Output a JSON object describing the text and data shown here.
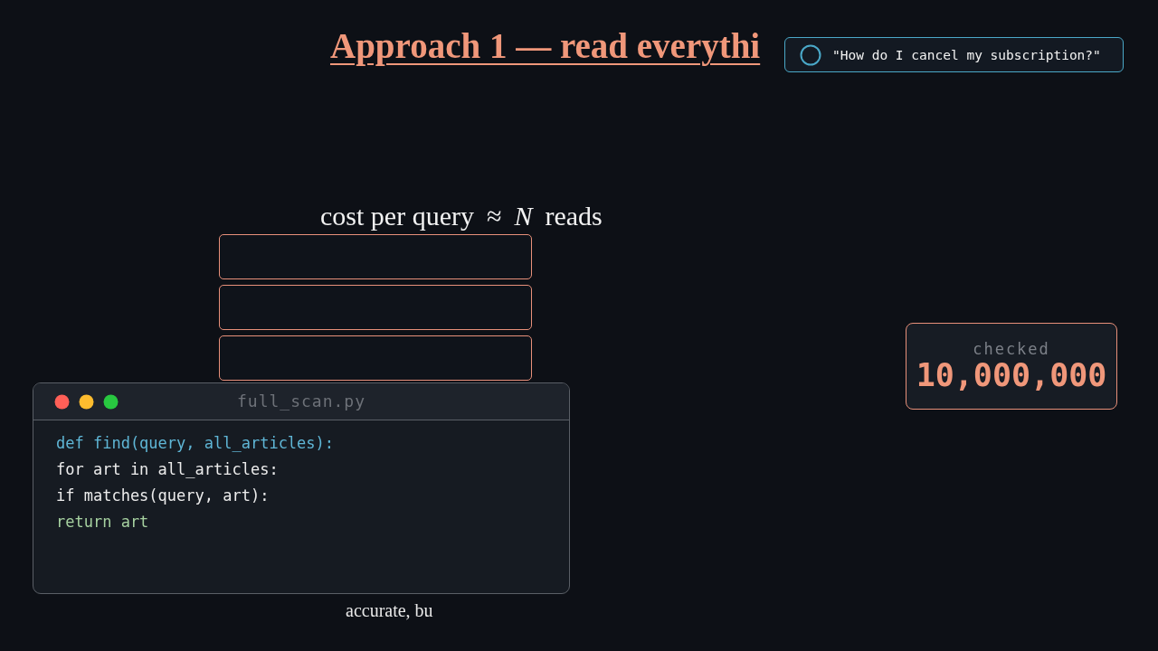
{
  "title": "Approach 1 — read everythi",
  "query": {
    "text": "\"How do I cancel my subscription?\""
  },
  "formula": {
    "text": "cost per query",
    "symbol": "≈",
    "variable": "N",
    "unit": "reads"
  },
  "article_cards": [
    {
      "kind": "card"
    },
    {
      "kind": "card"
    },
    {
      "kind": "card"
    }
  ],
  "editor": {
    "filename": "full_scan.py",
    "lines": [
      {
        "text": "def find(query, all_articles):",
        "kind": "signature"
      },
      {
        "text": "for art in all_articles:",
        "kind": "plain"
      },
      {
        "text": "if matches(query, art):",
        "kind": "plain"
      },
      {
        "text": "return art",
        "kind": "return"
      }
    ]
  },
  "counter": {
    "label": "checked",
    "value": "10,000,000"
  },
  "caption": "accurate, bu"
}
